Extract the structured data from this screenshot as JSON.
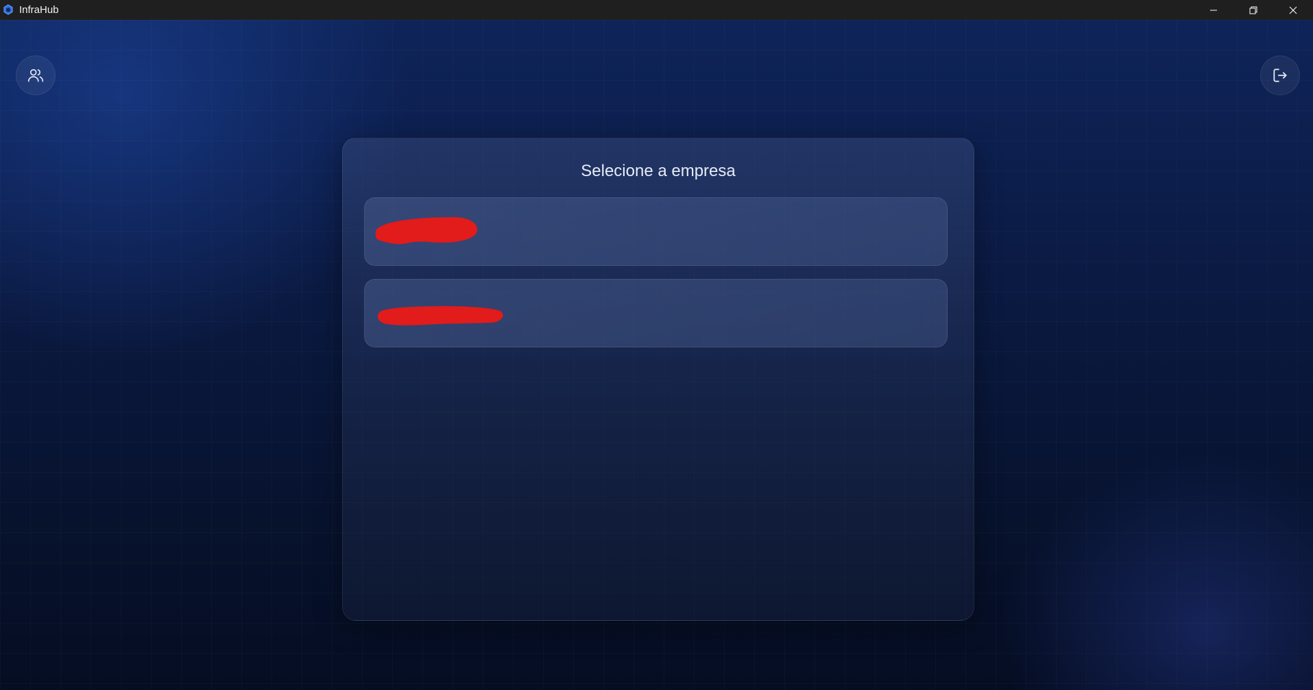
{
  "window": {
    "title": "InfraHub",
    "controls": [
      "minimize",
      "restore",
      "close"
    ]
  },
  "toolbar": {
    "left_icon": "users-icon",
    "right_icon": "logout-icon"
  },
  "main": {
    "title": "Selecione a empresa",
    "companies": [
      {
        "name": "",
        "redacted": true
      },
      {
        "name": "",
        "redacted": true
      }
    ]
  },
  "colors": {
    "titlebar": "#1f1f1f",
    "background": "#0b1b45",
    "accent": "#2f6fe0",
    "redaction": "#e21b1b"
  }
}
